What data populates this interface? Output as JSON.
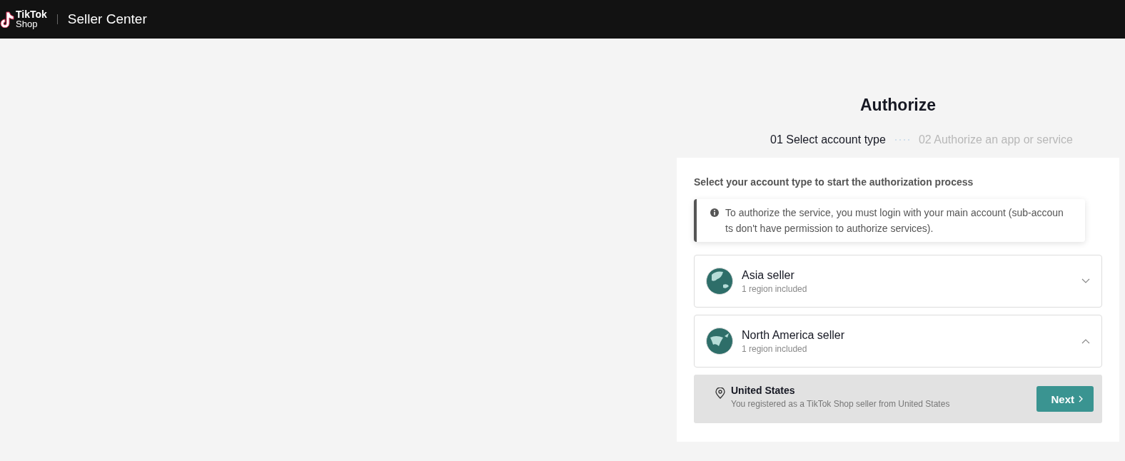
{
  "header": {
    "logo_top": "TikTok",
    "logo_bottom": "Shop",
    "title": "Seller Center"
  },
  "page": {
    "title": "Authorize",
    "steps": [
      {
        "label": "01 Select account type",
        "selected": true
      },
      {
        "label": "02 Authorize an app or service",
        "selected": false
      }
    ],
    "prompt": "Select your account type to start the authorization process",
    "notice": "To authorize the service, you must login with your main account (sub-accounts don't have permission to authorize services).",
    "accounts": [
      {
        "name": "Asia seller",
        "subtitle": "1 region included",
        "kind": "asia",
        "expanded": false
      },
      {
        "name": "North America seller",
        "subtitle": "1 region included",
        "kind": "north-america",
        "expanded": true,
        "region": {
          "name": "United States",
          "description": "You registered as a TikTok Shop seller from United States",
          "button": "Next"
        }
      }
    ]
  }
}
